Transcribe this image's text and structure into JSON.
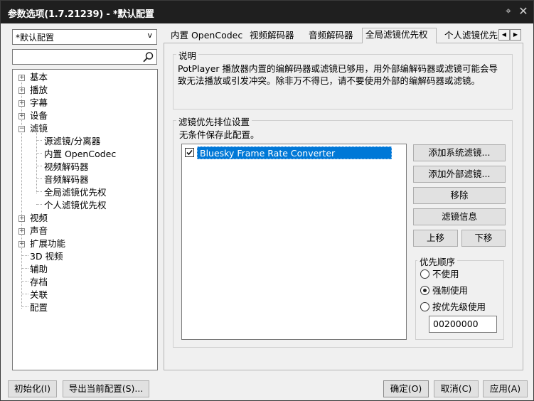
{
  "window": {
    "title": "参数选项(1.7.21239) - *默认配置"
  },
  "preset": {
    "value": "*默认配置"
  },
  "search": {
    "placeholder": ""
  },
  "tree": {
    "items": [
      {
        "label": "基本",
        "expandable": true
      },
      {
        "label": "播放",
        "expandable": true
      },
      {
        "label": "字幕",
        "expandable": true
      },
      {
        "label": "设备",
        "expandable": true
      },
      {
        "label": "滤镜",
        "expandable": true,
        "expanded": true
      },
      {
        "label": "源滤镜/分离器",
        "child": true
      },
      {
        "label": "内置 OpenCodec",
        "child": true
      },
      {
        "label": "视频解码器",
        "child": true
      },
      {
        "label": "音频解码器",
        "child": true
      },
      {
        "label": "全局滤镜优先权",
        "child": true
      },
      {
        "label": "个人滤镜优先权",
        "child": true
      },
      {
        "label": "视频",
        "expandable": true
      },
      {
        "label": "声音",
        "expandable": true
      },
      {
        "label": "扩展功能",
        "expandable": true
      },
      {
        "label": "3D 视频",
        "expandable": false
      },
      {
        "label": "辅助",
        "expandable": false
      },
      {
        "label": "存档",
        "expandable": false
      },
      {
        "label": "关联",
        "expandable": false
      },
      {
        "label": "配置",
        "expandable": false
      }
    ]
  },
  "tabs": [
    {
      "label": "内置 OpenCodec"
    },
    {
      "label": "视频解码器"
    },
    {
      "label": "音频解码器"
    },
    {
      "label": "全局滤镜优先权",
      "active": true
    },
    {
      "label": "个人滤镜优先"
    }
  ],
  "description": {
    "title": "说明",
    "text": "PotPlayer 播放器内置的编解码器或滤镜已够用，用外部编解码器或滤镜可能会导致无法播放或引发冲突。除非万不得已，请不要使用外部的编解码器或滤镜。"
  },
  "filter_priority": {
    "title": "滤镜优先排位设置",
    "subtitle": "无条件保存此配置。",
    "filters": [
      {
        "name": "Bluesky Frame Rate Converter",
        "checked": true
      }
    ],
    "buttons": {
      "add_system": "添加系统滤镜...",
      "add_external": "添加外部滤镜...",
      "remove": "移除",
      "info": "滤镜信息",
      "move_up": "上移",
      "move_down": "下移"
    },
    "priority": {
      "title": "优先顺序",
      "options": [
        "不使用",
        "强制使用",
        "按优先级使用"
      ],
      "selected": "强制使用",
      "value": "00200000"
    }
  },
  "footer": {
    "reset": "初始化(I)",
    "export": "导出当前配置(S)...",
    "ok": "确定(O)",
    "cancel": "取消(C)",
    "apply": "应用(A)"
  },
  "icons": {
    "pin": "pin-icon",
    "close": "close-icon",
    "search": "search-icon",
    "tab_left": "chevron-left-icon",
    "tab_right": "chevron-right-icon"
  }
}
